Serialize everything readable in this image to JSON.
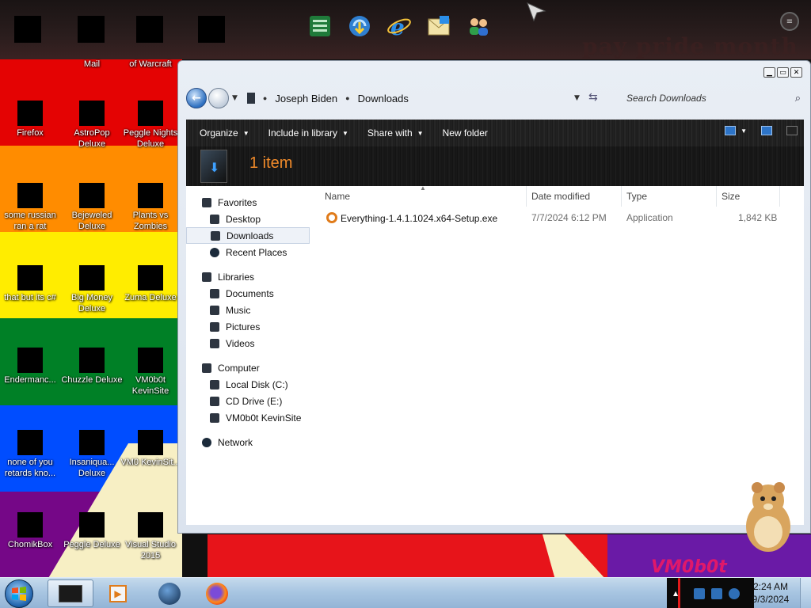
{
  "desktop": {
    "wallpaper_text": "pay pride month",
    "wallpaper_logo": "VM0b0t",
    "rainbow_colors": [
      "#e40303",
      "#ff8c00",
      "#ffed00",
      "#008026",
      "#004dff",
      "#750787"
    ],
    "top_row_labels": [
      "Mail",
      "of Warcraft"
    ],
    "icons": [
      {
        "label": "Firefox"
      },
      {
        "label": "AstroPop Deluxe"
      },
      {
        "label": "Peggle Nights Deluxe"
      },
      {
        "label": "some russian ran a rat"
      },
      {
        "label": "Bejeweled Deluxe"
      },
      {
        "label": "Plants vs Zombies"
      },
      {
        "label": "that but its c#"
      },
      {
        "label": "Big Money Deluxe"
      },
      {
        "label": "Zuma Deluxe"
      },
      {
        "label": "Endermanc..."
      },
      {
        "label": "Chuzzle Deluxe"
      },
      {
        "label": "VM0b0t KevinSite"
      },
      {
        "label": "none of you retards kno..."
      },
      {
        "label": "Insaniqua... Deluxe"
      },
      {
        "label": "VM0 KevinSit..."
      },
      {
        "label": "ChomikBox"
      },
      {
        "label": "Peggle Deluxe"
      },
      {
        "label": "Visual Studio 2015"
      }
    ]
  },
  "dock": {
    "items": [
      "excel-icon",
      "internet-download-icon",
      "internet-explorer-icon",
      "mail-icon",
      "users-icon"
    ]
  },
  "explorer": {
    "breadcrumb": [
      "Joseph Biden",
      "Downloads"
    ],
    "search_placeholder": "Search Downloads",
    "toolbar": {
      "organize": "Organize",
      "include_in_library": "Include in library",
      "share_with": "Share with",
      "new_folder": "New folder"
    },
    "item_count": "1 item",
    "nav": {
      "favorites": "Favorites",
      "desktop": "Desktop",
      "downloads": "Downloads",
      "recent_places": "Recent Places",
      "libraries": "Libraries",
      "documents": "Documents",
      "music": "Music",
      "pictures": "Pictures",
      "videos": "Videos",
      "computer": "Computer",
      "local_disk": "Local Disk (C:)",
      "cd_drive": "CD Drive (E:)",
      "kevinsite": "VM0b0t KevinSite",
      "network": "Network"
    },
    "columns": {
      "name": "Name",
      "date": "Date modified",
      "type": "Type",
      "size": "Size"
    },
    "files": [
      {
        "name": "Everything-1.4.1.1024.x64-Setup.exe",
        "date": "7/7/2024 6:12 PM",
        "type": "Application",
        "size": "1,842 KB"
      }
    ]
  },
  "taskbar": {
    "time": "2:24 AM",
    "date": "9/3/2024"
  }
}
